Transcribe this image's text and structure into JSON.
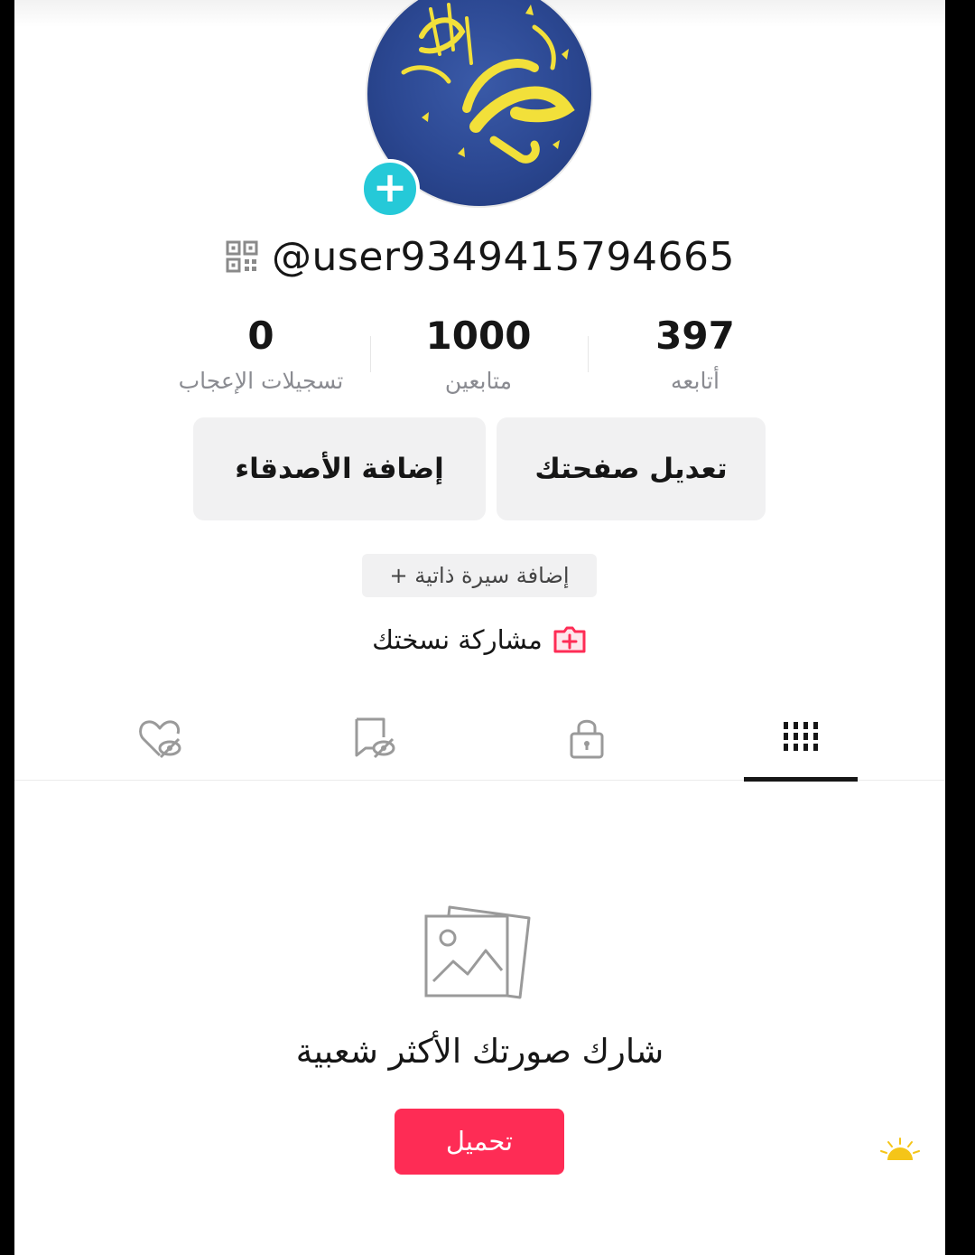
{
  "profile": {
    "username": "@user9349415794665",
    "stats": [
      {
        "value": "397",
        "label": "أتابعه"
      },
      {
        "value": "1000",
        "label": "متابعين"
      },
      {
        "value": "0",
        "label": "تسجيلات الإعجاب"
      }
    ],
    "edit_button": "تعديل صفحتك",
    "add_friends_button": "إضافة الأصدقاء",
    "add_bio_button": "+ إضافة سيرة ذاتية",
    "share_copy": "مشاركة نسختك"
  },
  "tabs": [
    {
      "icon": "grid-icon",
      "active": true
    },
    {
      "icon": "lock-icon",
      "active": false
    },
    {
      "icon": "saved-hidden-icon",
      "active": false
    },
    {
      "icon": "liked-hidden-icon",
      "active": false
    }
  ],
  "empty_state": {
    "title": "شارك صورتك الأكثر شعبية",
    "upload_button": "تحميل"
  },
  "colors": {
    "accent": "#fe2c55",
    "avatar_add": "#25c9d8",
    "avatar_bg": "#2b4791"
  }
}
